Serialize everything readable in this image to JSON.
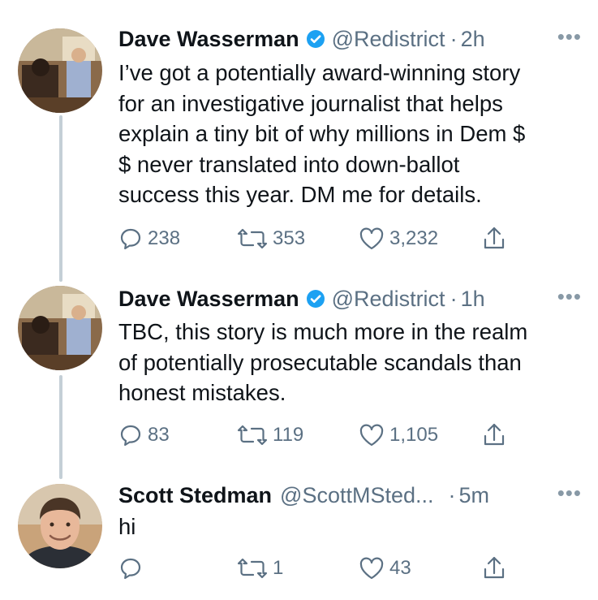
{
  "tweets": [
    {
      "name": "Dave Wasserman",
      "verified": true,
      "handle": "@Redistrict",
      "time": "2h",
      "text": "I’ve got a potentially award-winning story\nfor an investigative journalist that helps\nexplain a tiny bit of why millions in Dem $\n$ never translated into down-ballot\nsuccess this year. DM me for details.",
      "replies": "238",
      "retweets": "353",
      "likes": "3,232",
      "more": "•••"
    },
    {
      "name": "Dave Wasserman",
      "verified": true,
      "handle": "@Redistrict",
      "time": "1h",
      "text": "TBC, this story is much more in the realm\nof potentially prosecutable scandals than\nhonest mistakes.",
      "replies": "83",
      "retweets": "119",
      "likes": "1,105",
      "more": "•••"
    },
    {
      "name": "Scott Stedman",
      "verified": false,
      "handle": "@ScottMSted...",
      "time": "5m",
      "text": "hi",
      "replies": "",
      "retweets": "1",
      "likes": "43",
      "more": "•••"
    }
  ],
  "separator": "·",
  "colors": {
    "text": "#0f1419",
    "muted": "#5b7083",
    "verified": "#1da1f2",
    "thread_line": "#c4cfd6"
  }
}
